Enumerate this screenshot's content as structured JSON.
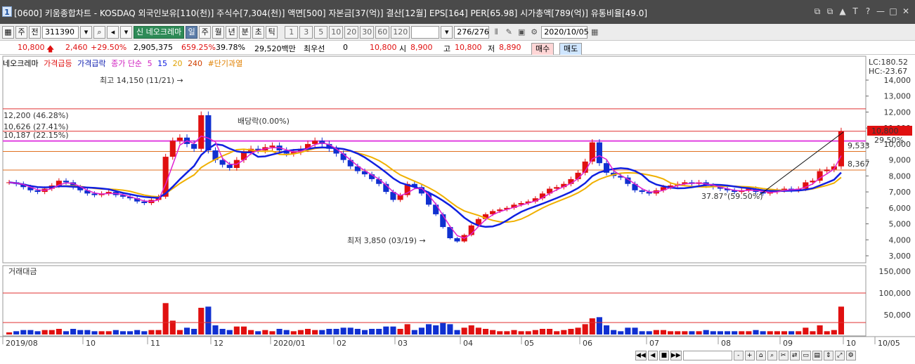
{
  "title_bar": {
    "window_number": "1",
    "title": "[0600] 키움종합차트 - KOSDAQ 외국인보유[110(천)] 주식수[7,304(천)] 액면[500] 자본금[37(억)] 결산[12월] EPS[164] PER[65.98] 시가총액[789(억)] 유통비율[49.0]",
    "controls": [
      "⧉",
      "⧉",
      "▲",
      "T",
      "?",
      "—",
      "□",
      "✕"
    ]
  },
  "toolbar": {
    "period_select": "주",
    "prev_button": "전",
    "code_value": "311390",
    "stock_name": "신 네오크레마",
    "interval_buttons": [
      "일",
      "주",
      "월",
      "년",
      "분",
      "초",
      "틱"
    ],
    "interval_selected": "일",
    "number_buttons": [
      "1",
      "3",
      "5",
      "10",
      "20",
      "30",
      "60",
      "120"
    ],
    "count_value": "276/276",
    "date_value": "2020/10/05"
  },
  "quote": {
    "price": "10,800",
    "change": "2,460",
    "change_pct": "+29.50%",
    "volume": "2,905,375",
    "volume_ratio": "659.25%",
    "turnover": "39.78%",
    "amount": "29,520백만",
    "pref_label": "최우선",
    "pref_value": "0",
    "pref_price": "10,800",
    "open_label": "시",
    "open": "8,900",
    "high_label": "고",
    "high": "10,800",
    "low_label": "저",
    "low": "8,890",
    "buy_label": "매수",
    "sell_label": "매도"
  },
  "legend": {
    "name": "네오크레마",
    "surge": "가격급등",
    "drop": "가격급락",
    "ma_label": "종가 단순",
    "ma5": "5",
    "ma15": "15",
    "ma20": "20",
    "ma240": "240",
    "overheat": "#단기과열"
  },
  "volume_panel": {
    "title": "거래대금"
  },
  "chart_data": {
    "type": "candlestick",
    "y_axis": {
      "min": 3000,
      "max": 14000,
      "ticks": [
        "14,000",
        "13,000",
        "12,000",
        "11,000",
        "10,000",
        "9,000",
        "8,000",
        "7,000",
        "6,000",
        "5,000",
        "4,000",
        "3,000"
      ]
    },
    "volume_axis": {
      "ticks": [
        "150,000",
        "100,000",
        "50,000"
      ]
    },
    "x_ticks": [
      "2019/08",
      "10",
      "11",
      "12",
      "2020/01",
      "02",
      "03",
      "04",
      "05",
      "06",
      "07",
      "08",
      "09",
      "10",
      "10/05"
    ],
    "scale_labels": {
      "lc": "LC:180.52",
      "hc": "HC:-23.67"
    },
    "annotations": {
      "high": "최고 14,150 (11/21)",
      "low": "최저 3,850 (03/19)",
      "dividend": "배당락(0.00%)",
      "level1": "12,200 (46.28%)",
      "level2": "10,626 (27.41%)",
      "level3": "10,187 (22.15%)",
      "angle": "37.87°(59.50%)",
      "last_price": "10,800",
      "last_pct": "29.50%",
      "val1": "9,533",
      "val2": "8,367"
    },
    "close_series": [
      7600,
      7500,
      7300,
      7100,
      7000,
      7200,
      7400,
      7700,
      7600,
      7300,
      7100,
      6900,
      6800,
      6900,
      7000,
      6800,
      6700,
      6600,
      6400,
      6300,
      6500,
      6700,
      9200,
      10200,
      10400,
      10000,
      9700,
      11800,
      9600,
      9000,
      8700,
      8500,
      9000,
      9500,
      9700,
      9600,
      9800,
      9900,
      9600,
      9400,
      9500,
      9700,
      10000,
      10200,
      10000,
      9700,
      9400,
      9000,
      8600,
      8300,
      8100,
      7800,
      7500,
      7000,
      6500,
      6800,
      7500,
      7300,
      6900,
      6200,
      5600,
      4800,
      4100,
      3900,
      4300,
      4900,
      5300,
      5600,
      5800,
      5900,
      6000,
      6200,
      6300,
      6400,
      6600,
      6900,
      7200,
      7300,
      7500,
      7800,
      8200,
      8900,
      10100,
      8800,
      8200,
      8000,
      7900,
      7500,
      7100,
      7000,
      6900,
      7100,
      7300,
      7400,
      7500,
      7600,
      7500,
      7600,
      7400,
      7300,
      7200,
      7100,
      7000,
      7100,
      7200,
      7000,
      6900,
      7000,
      7100,
      7200,
      7100,
      7200,
      7600,
      7700,
      8300,
      8400,
      8600,
      10800
    ]
  }
}
